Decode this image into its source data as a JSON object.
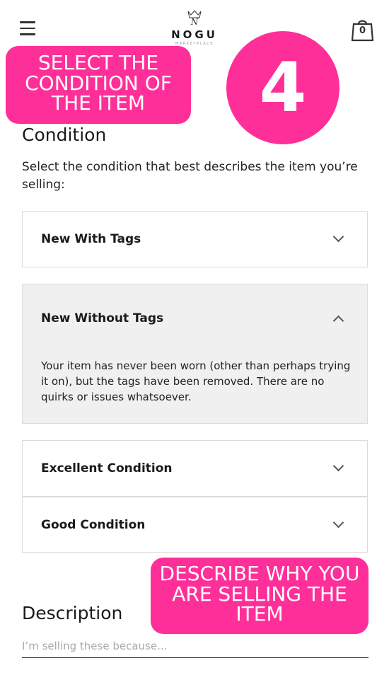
{
  "header": {
    "menu_icon": "hamburger-menu-icon",
    "logo_name": "NOGU",
    "logo_sub": "MARKETPLACE",
    "cart_icon": "shopping-bag-icon",
    "cart_count": "0"
  },
  "annotations": {
    "step_one_text": "SELECT THE CONDITION OF THE ITEM",
    "step_number": "4",
    "step_two_text": "DESCRIBE WHY YOU ARE SELLING THE ITEM",
    "accent_color": "#ff2f99"
  },
  "condition": {
    "title": "Condition",
    "subtitle": "Select the condition that best describes the item you’re selling:",
    "options": [
      {
        "label": "New With Tags",
        "expanded": false
      },
      {
        "label": "New Without Tags",
        "expanded": true,
        "description": "Your item has never been worn (other than perhaps trying it on), but the tags have been removed. There are no quirks or issues whatsoever."
      },
      {
        "label": "Excellent Condition",
        "expanded": false
      },
      {
        "label": "Good Condition",
        "expanded": false
      }
    ]
  },
  "description": {
    "title": "Description",
    "placeholder": "I’m selling these because..."
  }
}
